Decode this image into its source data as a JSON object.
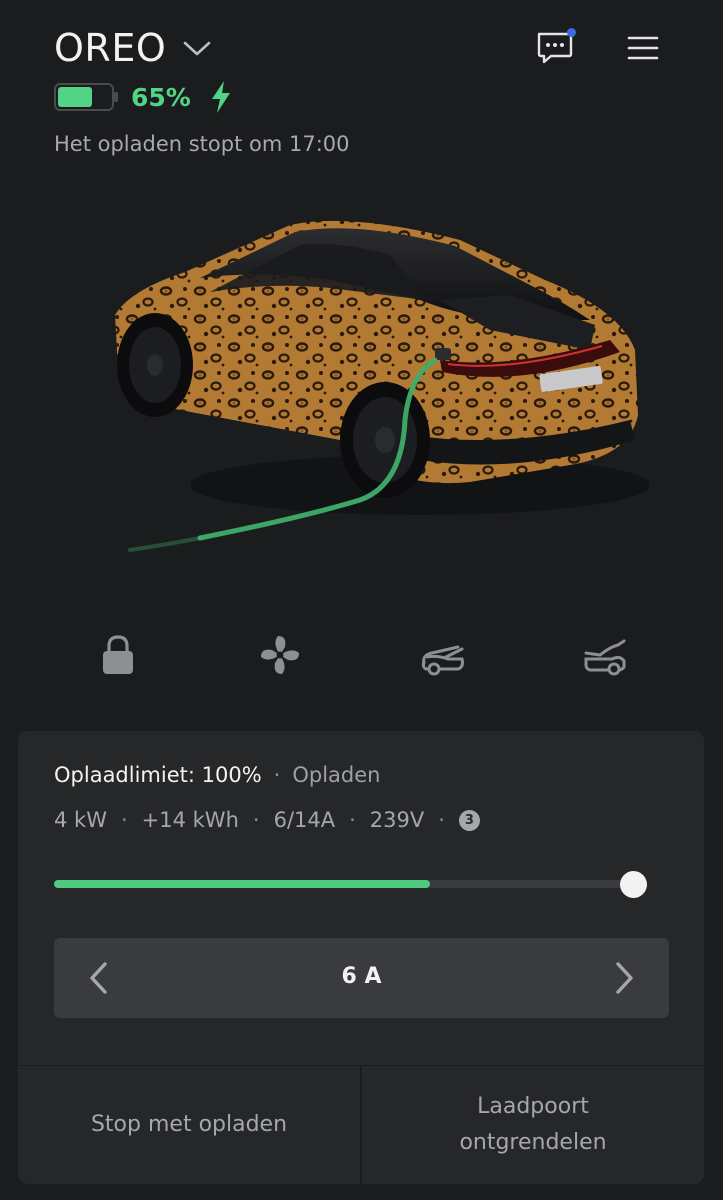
{
  "header": {
    "car_name": "OREO",
    "battery_percent": "65%",
    "battery_level": 0.65,
    "charging": true,
    "status": "Het opladen stopt om 17:00"
  },
  "icons": {
    "dropdown": "chevron-down-icon",
    "messages": "chat-icon",
    "menu": "hamburger-menu-icon",
    "lock": "lock-icon",
    "climate": "fan-icon",
    "frunk": "frunk-icon",
    "trunk": "trunk-icon",
    "charge": "lightning-bolt-icon"
  },
  "colors": {
    "accent_green": "#52d486",
    "notification": "#3e6ae1",
    "background": "#1b1c1e",
    "card": "#262729"
  },
  "charging_panel": {
    "limit_label": "Oplaadlimiet: 100%",
    "state": "Opladen",
    "stats": {
      "power": "4 kW",
      "energy_added": "+14 kWh",
      "current": "6/14A",
      "voltage": "239V",
      "phases": "3"
    },
    "slider": {
      "charge_level": 0.65,
      "limit_level": 1.0
    },
    "amps": {
      "value": "6 A",
      "prev_symbol": "‹",
      "next_symbol": "›"
    },
    "stop_button": "Stop met opladen",
    "unlock_port_line1": "Laadpoort",
    "unlock_port_line2": "ontgrendelen"
  }
}
